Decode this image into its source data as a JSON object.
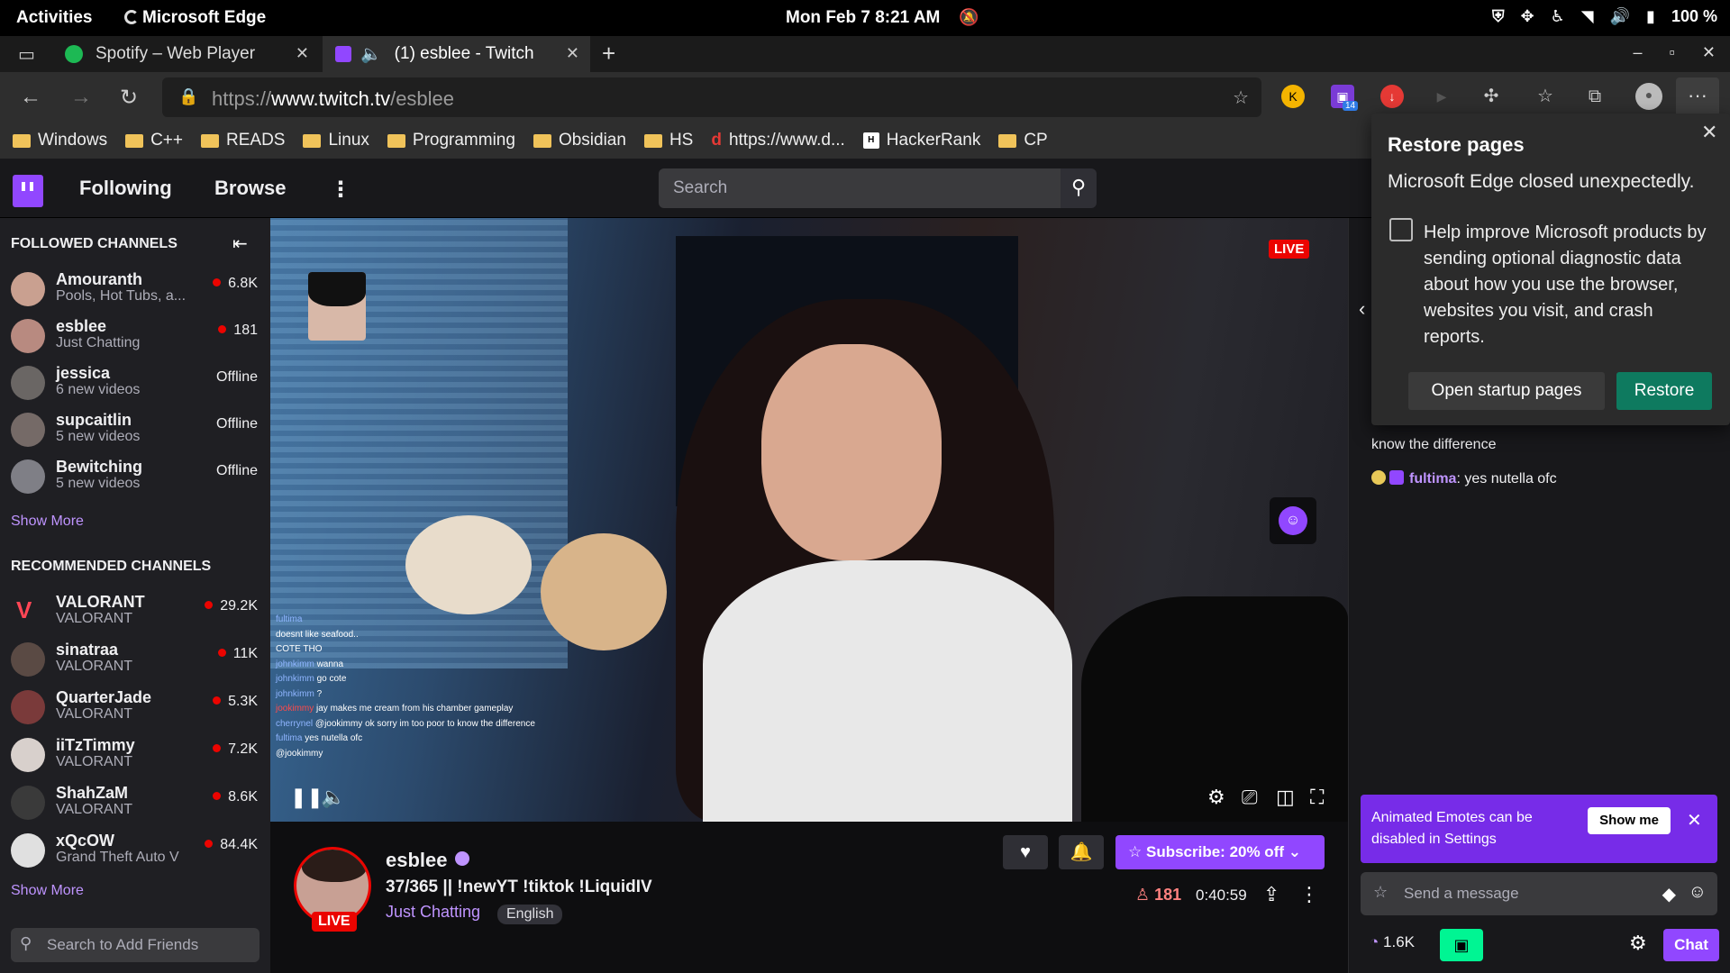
{
  "topbar": {
    "activities": "Activities",
    "app": "Microsoft Edge",
    "clock": "Mon Feb 7  8:21 AM",
    "battery": "100 %"
  },
  "tabs": [
    {
      "title": "Spotify – Web Player",
      "icon": "spotify-icon"
    },
    {
      "title": "(1) esblee - Twitch",
      "icon": "twitch-icon",
      "active": true
    }
  ],
  "address": {
    "scheme": "https://",
    "host": "www.twitch.tv",
    "path": "/esblee",
    "ext_badge": "14"
  },
  "bookmarks": [
    {
      "label": "Windows",
      "type": "folder"
    },
    {
      "label": "C++",
      "type": "folder"
    },
    {
      "label": "READS",
      "type": "folder"
    },
    {
      "label": "Linux",
      "type": "folder"
    },
    {
      "label": "Programming",
      "type": "folder"
    },
    {
      "label": "Obsidian",
      "type": "folder"
    },
    {
      "label": "HS",
      "type": "folder"
    },
    {
      "label": "https://www.d...",
      "type": "link"
    },
    {
      "label": "HackerRank",
      "type": "link"
    },
    {
      "label": "CP",
      "type": "folder"
    }
  ],
  "twitch": {
    "nav_following": "Following",
    "nav_browse": "Browse",
    "search_placeholder": "Search"
  },
  "sidebar": {
    "followed_heading": "FOLLOWED CHANNELS",
    "followed": [
      {
        "name": "Amouranth",
        "sub": "Pools, Hot Tubs, a...",
        "viewers": "6.8K",
        "live": true
      },
      {
        "name": "esblee",
        "sub": "Just Chatting",
        "viewers": "181",
        "live": true
      },
      {
        "name": "jessica",
        "sub": "6 new videos",
        "viewers": "Offline",
        "live": false
      },
      {
        "name": "supcaitlin",
        "sub": "5 new videos",
        "viewers": "Offline",
        "live": false
      },
      {
        "name": "Bewitching",
        "sub": "5 new videos",
        "viewers": "Offline",
        "live": false
      }
    ],
    "show_more_1": "Show More",
    "recommended_heading": "RECOMMENDED CHANNELS",
    "recommended": [
      {
        "name": "VALORANT",
        "sub": "VALORANT",
        "viewers": "29.2K"
      },
      {
        "name": "sinatraa",
        "sub": "VALORANT",
        "viewers": "11K"
      },
      {
        "name": "QuarterJade",
        "sub": "VALORANT",
        "viewers": "5.3K"
      },
      {
        "name": "iiTzTimmy",
        "sub": "VALORANT",
        "viewers": "7.2K"
      },
      {
        "name": "ShahZaM",
        "sub": "VALORANT",
        "viewers": "8.6K"
      },
      {
        "name": "xQcOW",
        "sub": "Grand Theft Auto V",
        "viewers": "84.4K"
      }
    ],
    "show_more_2": "Show More",
    "friends_placeholder": "Search to Add Friends"
  },
  "video": {
    "live_badge": "LIVE",
    "overlay_chat": [
      {
        "user": "fultima",
        "text": ""
      },
      {
        "user": "",
        "text": "doesnt like seafood.."
      },
      {
        "user": "",
        "text": "COTE THO"
      },
      {
        "user": "johnkimm",
        "text": "wanna"
      },
      {
        "user": "johnkimm",
        "text": "go cote"
      },
      {
        "user": "johnkimm",
        "text": "?"
      },
      {
        "user": "jookimmy",
        "text": "jay makes me cream from his chamber gameplay"
      },
      {
        "user": "cherrynel",
        "text": "@jookimmy ok sorry im too poor to know the difference"
      },
      {
        "user": "fultima",
        "text": "yes nutella ofc"
      },
      {
        "user": "",
        "text": "@jookimmy"
      }
    ]
  },
  "channel": {
    "name": "esblee",
    "title": "37/365 || !newYT !tiktok !LiquidIV",
    "category": "Just Chatting",
    "tag": "English",
    "live": "LIVE",
    "subscribe": "Subscribe: 20% off",
    "viewers": "181",
    "uptime": "0:40:59"
  },
  "chat": {
    "line1_tail": "know the difference",
    "line2_user": "fultima",
    "line2_text": ": yes nutella ofc",
    "banner": "Animated Emotes can be disabled in Settings",
    "show_me": "Show me",
    "placeholder": "Send a message",
    "points": "1.6K",
    "chat_btn": "Chat"
  },
  "restore": {
    "title": "Restore pages",
    "message": "Microsoft Edge closed unexpectedly.",
    "checkbox_label": "Help improve Microsoft products by sending optional diagnostic data about how you use the browser, websites you visit, and crash reports.",
    "startup_btn": "Open startup pages",
    "restore_btn": "Restore"
  },
  "colors": {
    "twitch_purple": "#9147ff",
    "live_red": "#eb0400",
    "restore_green": "#0e7a5f"
  }
}
